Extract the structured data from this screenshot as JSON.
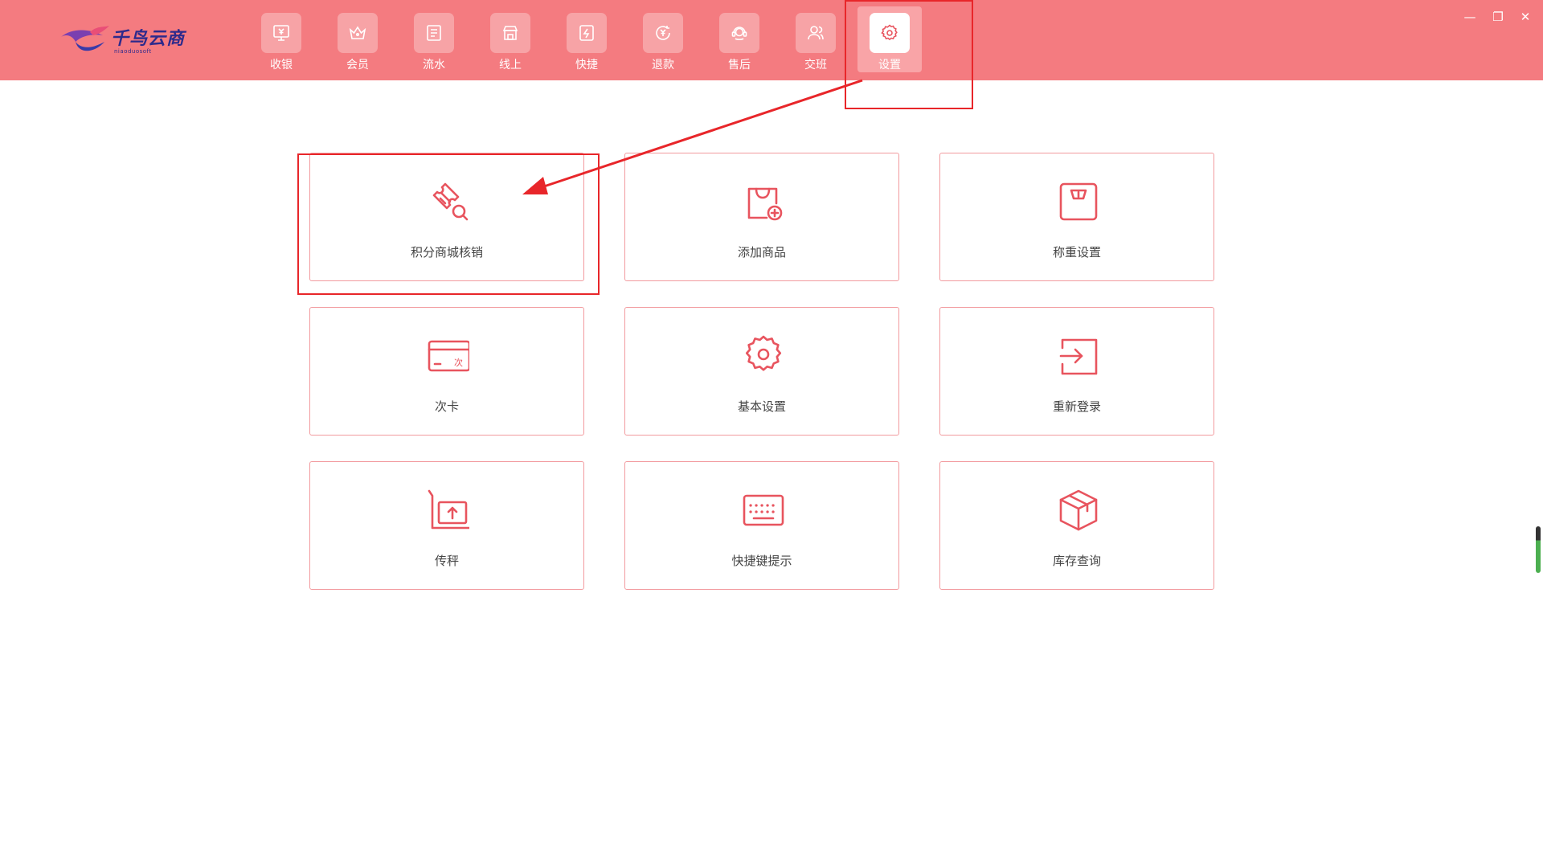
{
  "app": {
    "logo_text": "千鸟云商",
    "logo_sub": "niaoduosoft"
  },
  "colors": {
    "topbar": "#f47b80",
    "accent": "#e8545e",
    "card_border": "#f29a9e",
    "annotation": "#e8262a"
  },
  "nav": {
    "items": [
      {
        "label": "收银",
        "icon": "cashier-icon"
      },
      {
        "label": "会员",
        "icon": "crown-icon"
      },
      {
        "label": "流水",
        "icon": "ledger-icon"
      },
      {
        "label": "线上",
        "icon": "shop-icon"
      },
      {
        "label": "快捷",
        "icon": "shortcut-icon"
      },
      {
        "label": "退款",
        "icon": "refund-icon"
      },
      {
        "label": "售后",
        "icon": "headset-icon"
      },
      {
        "label": "交班",
        "icon": "users-icon"
      },
      {
        "label": "设置",
        "icon": "gear-icon",
        "active": true
      }
    ]
  },
  "window_controls": {
    "minimize": "—",
    "restore": "❐",
    "close": "✕"
  },
  "cards": [
    {
      "label": "积分商城核销",
      "icon": "ticket-search-icon"
    },
    {
      "label": "添加商品",
      "icon": "bag-add-icon"
    },
    {
      "label": "称重设置",
      "icon": "scale-icon"
    },
    {
      "label": "次卡",
      "icon": "card-icon",
      "icon_text": "次"
    },
    {
      "label": "基本设置",
      "icon": "gear-icon"
    },
    {
      "label": "重新登录",
      "icon": "login-icon"
    },
    {
      "label": "传秤",
      "icon": "upload-scale-icon"
    },
    {
      "label": "快捷键提示",
      "icon": "keyboard-icon"
    },
    {
      "label": "库存查询",
      "icon": "box-icon"
    }
  ]
}
